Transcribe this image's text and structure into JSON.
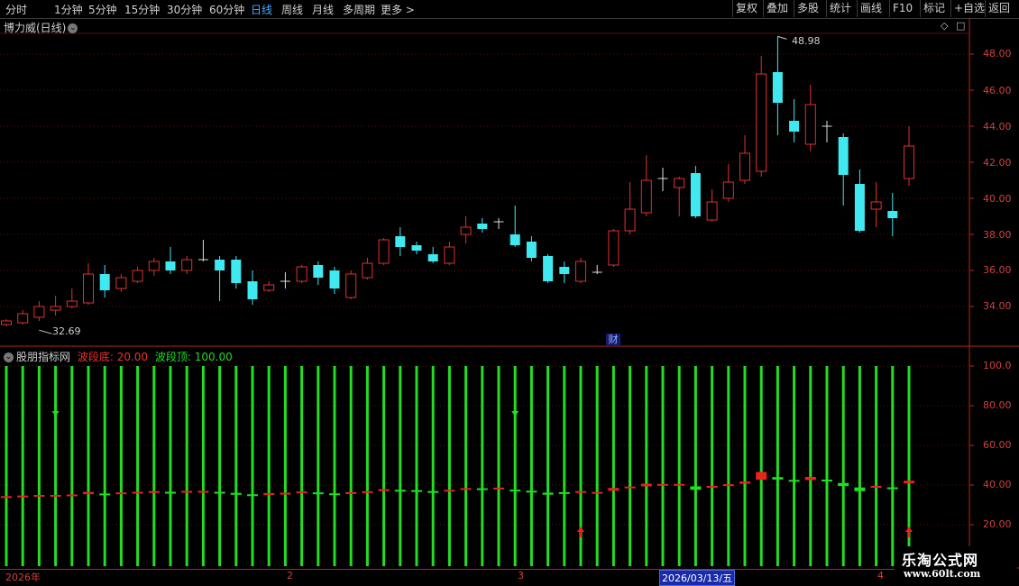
{
  "toolbar": {
    "timeframes": [
      "分时",
      "1分钟",
      "5分钟",
      "15分钟",
      "30分钟",
      "60分钟",
      "日线",
      "周线",
      "月线",
      "多周期",
      "更多 >"
    ],
    "active": "日线",
    "right_buttons": [
      "复权",
      "叠加",
      "多股",
      "统计",
      "画线",
      "F10",
      "标记",
      "+自选",
      "返回"
    ]
  },
  "main_panel": {
    "title": "博力威(日线)",
    "high_label": "48.98",
    "low_label": "32.69",
    "marker": "财",
    "y_ticks": [
      "48.00",
      "46.00",
      "44.00",
      "42.00",
      "40.00",
      "38.00",
      "36.00",
      "34.00"
    ]
  },
  "indicator_panel": {
    "name": "股朋指标网",
    "bottom_label": "波段底: 20.00",
    "top_label": "波段顶: 100.00",
    "y_ticks": [
      "100.0",
      "80.00",
      "60.00",
      "40.00",
      "20.00"
    ]
  },
  "date_axis": {
    "labels": [
      "2026年",
      "2",
      "3",
      "4"
    ],
    "selected": "2026/03/13/五"
  },
  "watermark": {
    "line1": "乐淘公式网",
    "line2": "www.60lt.com"
  },
  "colors": {
    "up": "#e03030",
    "down": "#40e8f0",
    "indicator_green": "#22dd22",
    "indicator_red": "#ee2020",
    "grid": "#5a1010",
    "axis_text": "#d04040"
  },
  "chart_data": [
    {
      "type": "candlestick",
      "title": "博力威(日线)",
      "ylim": [
        32,
        49.5
      ],
      "y_ticks": [
        34,
        36,
        38,
        40,
        42,
        44,
        46,
        48
      ],
      "max_label": 48.98,
      "min_label": 32.69,
      "candles": [
        [
          33.0,
          33.3,
          33.2,
          32.9
        ],
        [
          33.1,
          33.8,
          33.6,
          33.0
        ],
        [
          33.4,
          34.3,
          34.0,
          33.2
        ],
        [
          33.8,
          34.6,
          34.0,
          33.5
        ],
        [
          34.0,
          35.0,
          34.3,
          33.9
        ],
        [
          34.2,
          36.4,
          35.8,
          34.1
        ],
        [
          35.8,
          36.3,
          34.9,
          34.5
        ],
        [
          35.0,
          35.8,
          35.6,
          34.8
        ],
        [
          35.4,
          36.2,
          36.0,
          35.3
        ],
        [
          36.0,
          36.7,
          36.5,
          35.7
        ],
        [
          36.5,
          37.3,
          36.0,
          35.8
        ],
        [
          36.0,
          36.8,
          36.6,
          35.8
        ],
        [
          36.6,
          37.7,
          36.6,
          36.5
        ],
        [
          36.6,
          36.8,
          36.0,
          34.3
        ],
        [
          36.6,
          36.8,
          35.3,
          35.0
        ],
        [
          35.4,
          36.0,
          34.4,
          34.1
        ],
        [
          34.9,
          35.4,
          35.2,
          34.8
        ],
        [
          35.3,
          35.9,
          35.4,
          35.0
        ],
        [
          35.4,
          36.3,
          36.2,
          35.3
        ],
        [
          36.3,
          36.5,
          35.6,
          35.2
        ],
        [
          36.0,
          36.2,
          35.0,
          34.7
        ],
        [
          34.5,
          36.0,
          35.8,
          34.4
        ],
        [
          35.6,
          36.7,
          36.4,
          35.5
        ],
        [
          36.4,
          37.8,
          37.7,
          36.3
        ],
        [
          37.9,
          38.4,
          37.3,
          36.8
        ],
        [
          37.4,
          37.6,
          37.1,
          36.9
        ],
        [
          36.9,
          37.3,
          36.5,
          36.4
        ],
        [
          36.4,
          37.6,
          37.3,
          36.3
        ],
        [
          38.0,
          39.0,
          38.4,
          37.5
        ],
        [
          38.6,
          38.9,
          38.3,
          38.1
        ],
        [
          38.6,
          38.9,
          38.7,
          38.3
        ],
        [
          38.0,
          39.6,
          37.4,
          37.3
        ],
        [
          37.6,
          37.9,
          36.7,
          36.5
        ],
        [
          36.8,
          36.9,
          35.4,
          35.3
        ],
        [
          36.2,
          36.5,
          35.8,
          35.3
        ],
        [
          35.4,
          36.7,
          36.5,
          35.3
        ],
        [
          35.8,
          36.3,
          35.9,
          35.8
        ],
        [
          36.3,
          38.3,
          38.2,
          36.2
        ],
        [
          38.2,
          40.9,
          39.4,
          38.0
        ],
        [
          39.2,
          42.4,
          41.0,
          39.0
        ],
        [
          41.0,
          41.7,
          41.1,
          40.4
        ],
        [
          40.6,
          41.2,
          41.1,
          39.0
        ],
        [
          41.4,
          41.8,
          39.0,
          38.9
        ],
        [
          38.8,
          40.5,
          39.8,
          38.7
        ],
        [
          40.0,
          41.9,
          40.9,
          39.8
        ],
        [
          41.0,
          43.5,
          42.5,
          40.8
        ],
        [
          41.5,
          47.9,
          46.9,
          41.2
        ],
        [
          47.0,
          48.98,
          45.3,
          43.5
        ],
        [
          44.3,
          45.5,
          43.7,
          43.1
        ],
        [
          43.0,
          46.3,
          45.2,
          42.6
        ],
        [
          44.0,
          44.3,
          43.9,
          43.1
        ],
        [
          43.4,
          43.6,
          41.3,
          39.6
        ],
        [
          40.8,
          41.6,
          38.2,
          38.1
        ],
        [
          39.4,
          40.9,
          39.8,
          38.4
        ],
        [
          39.3,
          40.3,
          38.9,
          37.9
        ],
        [
          41.1,
          44.0,
          42.9,
          40.7
        ]
      ]
    },
    {
      "type": "indicator",
      "name": "股朋指标网",
      "ylim": [
        10,
        105
      ],
      "y_ticks": [
        100,
        80,
        60,
        40,
        20
      ],
      "bottom_line": 20.0,
      "top_line": 100.0
    }
  ]
}
